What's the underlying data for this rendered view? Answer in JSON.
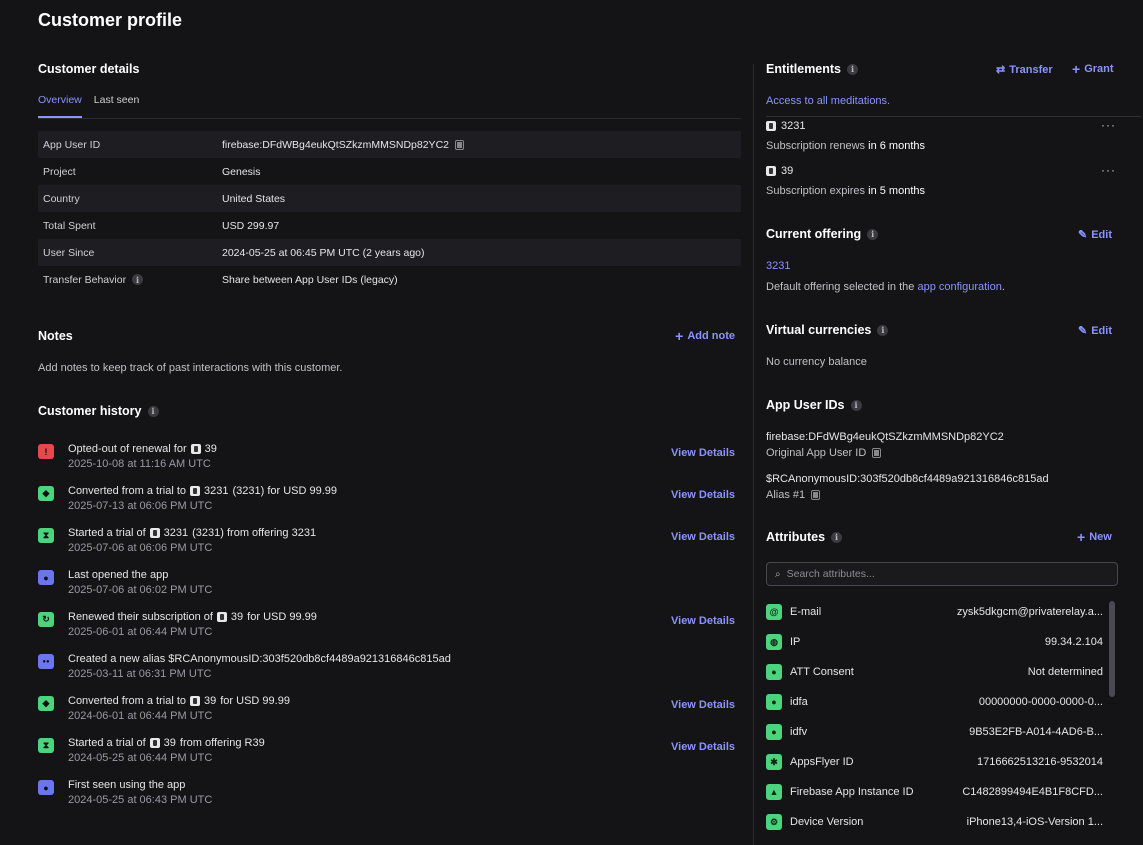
{
  "page_title": "Customer profile",
  "customer_details": {
    "heading": "Customer details",
    "tabs": [
      "Overview",
      "Last seen"
    ],
    "rows": [
      {
        "label": "App User ID",
        "value": "firebase:DFdWBg4eukQtSZkzmMMSNDp82YC2"
      },
      {
        "label": "Project",
        "value": "Genesis"
      },
      {
        "label": "Country",
        "value": "United States"
      },
      {
        "label": "Total Spent",
        "value": "USD 299.97"
      },
      {
        "label": "User Since",
        "value": "2024-05-25 at 06:45 PM UTC (2 years ago)"
      },
      {
        "label": "Transfer Behavior",
        "value": "Share between App User IDs (legacy)"
      }
    ]
  },
  "notes": {
    "heading": "Notes",
    "add_label": "Add note",
    "empty_text": "Add notes to keep track of past interactions with this customer."
  },
  "history": {
    "heading": "Customer history",
    "view_label": "View Details",
    "items": [
      {
        "icon": "warning-icon",
        "color": "#e5484d",
        "pre": "Opted-out of renewal for",
        "product": "39",
        "post": "",
        "date": "2025-10-08 at 11:16 AM UTC",
        "link": true
      },
      {
        "icon": "tag-icon",
        "color": "#4cd37e",
        "pre": "Converted from a trial to",
        "product": "3231",
        "post": "(3231) for USD 99.99",
        "date": "2025-07-13 at 06:06 PM UTC",
        "link": true
      },
      {
        "icon": "hourglass-icon",
        "color": "#4cd37e",
        "pre": "Started a trial of",
        "product": "3231",
        "post": "(3231) from offering 3231",
        "date": "2025-07-06 at 06:06 PM UTC",
        "link": true
      },
      {
        "icon": "user-icon",
        "color": "#6b75f0",
        "pre": "Last opened the app",
        "product": "",
        "post": "",
        "date": "2025-07-06 at 06:02 PM UTC",
        "link": false
      },
      {
        "icon": "renew-icon",
        "color": "#4cd37e",
        "pre": "Renewed their subscription of",
        "product": "39",
        "post": "for USD 99.99",
        "date": "2025-06-01 at 06:44 PM UTC",
        "link": true
      },
      {
        "icon": "users-icon",
        "color": "#6b75f0",
        "pre": "Created a new alias $RCAnonymousID:303f520db8cf4489a921316846c815ad",
        "product": "",
        "post": "",
        "date": "2025-03-11 at 06:31 PM UTC",
        "link": false
      },
      {
        "icon": "tag-icon",
        "color": "#4cd37e",
        "pre": "Converted from a trial to",
        "product": "39",
        "post": "for USD 99.99",
        "date": "2024-06-01 at 06:44 PM UTC",
        "link": true
      },
      {
        "icon": "hourglass-icon",
        "color": "#4cd37e",
        "pre": "Started a trial of",
        "product": "39",
        "post": "from offering R39",
        "date": "2024-05-25 at 06:44 PM UTC",
        "link": true
      },
      {
        "icon": "user-icon",
        "color": "#6b75f0",
        "pre": "First seen using the app",
        "product": "",
        "post": "",
        "date": "2024-05-25 at 06:43 PM UTC",
        "link": false
      }
    ]
  },
  "entitlements": {
    "heading": "Entitlements",
    "transfer_label": "Transfer",
    "grant_label": "Grant",
    "access_text": "Access to all meditations.",
    "items": [
      {
        "product": "3231",
        "status_pre": "Subscription renews",
        "status_bold": "in 6 months"
      },
      {
        "product": "39",
        "status_pre": "Subscription expires",
        "status_bold": "in 5 months"
      }
    ]
  },
  "current_offering": {
    "heading": "Current offering",
    "edit_label": "Edit",
    "offering": "3231",
    "desc_pre": "Default offering selected in the",
    "desc_link": "app configuration",
    "desc_post": "."
  },
  "virtual_currencies": {
    "heading": "Virtual currencies",
    "edit_label": "Edit",
    "empty_text": "No currency balance"
  },
  "app_user_ids": {
    "heading": "App User IDs",
    "ids": [
      {
        "id": "firebase:DFdWBg4eukQtSZkzmMMSNDp82YC2",
        "label": "Original App User ID"
      },
      {
        "id": "$RCAnonymousID:303f520db8cf4489a921316846c815ad",
        "label": "Alias #1"
      }
    ]
  },
  "attributes": {
    "heading": "Attributes",
    "new_label": "New",
    "search_placeholder": "Search attributes...",
    "rows": [
      {
        "icon": "at-icon",
        "glyph": "@",
        "name": "E-mail",
        "value": "zysk5dkgcm@privaterelay.a..."
      },
      {
        "icon": "globe-icon",
        "glyph": "◍",
        "name": "IP",
        "value": "99.34.2.104"
      },
      {
        "icon": "apple-icon",
        "glyph": "●",
        "name": "ATT Consent",
        "value": "Not determined"
      },
      {
        "icon": "apple-icon",
        "glyph": "●",
        "name": "idfa",
        "value": "00000000-0000-0000-0..."
      },
      {
        "icon": "apple-icon",
        "glyph": "●",
        "name": "idfv",
        "value": "9B53E2FB-A014-4AD6-B..."
      },
      {
        "icon": "appsflyer-icon",
        "glyph": "✱",
        "name": "AppsFlyer ID",
        "value": "1716662513216-9532014"
      },
      {
        "icon": "firebase-icon",
        "glyph": "▲",
        "name": "Firebase App Instance ID",
        "value": "C1482899494E4B1F8CFD..."
      },
      {
        "icon": "gear-icon",
        "glyph": "⚙",
        "name": "Device Version",
        "value": "iPhone13,4-iOS-Version 1..."
      }
    ]
  }
}
